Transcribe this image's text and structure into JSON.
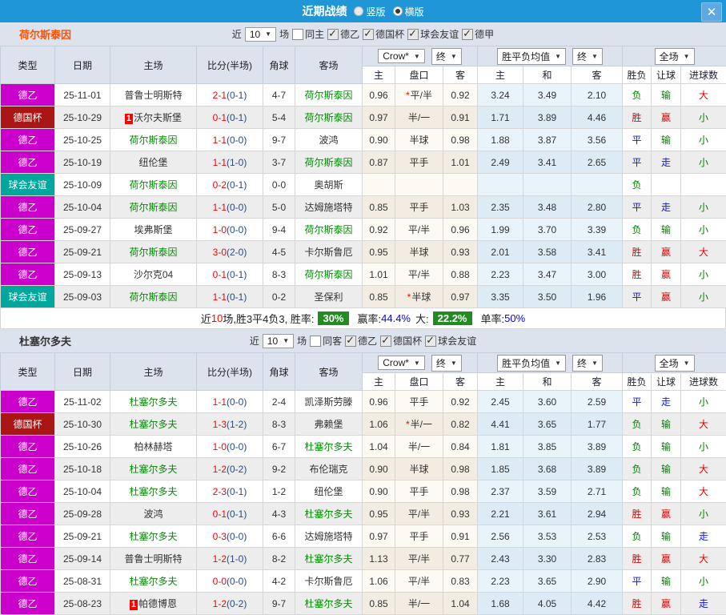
{
  "titlebar": {
    "title": "近期战绩",
    "radio_vertical": "竖版",
    "radio_horizontal": "横版",
    "close": "✕"
  },
  "labels": {
    "near": "近",
    "matches": "场"
  },
  "dd": {
    "crow": "Crow*",
    "final": "终",
    "avg": "胜平负均值",
    "full": "全场"
  },
  "table_header": {
    "league": "类型",
    "date": "日期",
    "home": "主场",
    "score": "比分(半场)",
    "corner": "角球",
    "away": "客场",
    "sub": [
      "主",
      "盘口",
      "客",
      "主",
      "和",
      "客",
      "胜负",
      "让球",
      "进球数"
    ]
  },
  "colors": {
    "topbar": "#1f96d5",
    "band": "#dde3ed",
    "score_red": "#ff0000",
    "halftime_navy": "#2b4b7c",
    "green_team": "#009000",
    "badge_green": "#228b22",
    "pct_blue": "#0000ff"
  },
  "league_colors": {
    "德乙": "#cc00cc",
    "德国杯": "#aa1616",
    "球会友谊": "#00a79d"
  },
  "result_colors": {
    "胜": "#e00000",
    "平": "#1414cc",
    "负": "#008000",
    "赢": "#e00000",
    "走": "#1414cc",
    "输": "#008000",
    "大": "#e00000",
    "小": "#008000"
  },
  "teams": [
    {
      "name": "荷尔斯泰因",
      "name_color": "#ff5100",
      "filters": {
        "count": "10",
        "same_label": "同主",
        "leagues": [
          "德乙",
          "德国杯",
          "球会友谊",
          "德甲"
        ]
      },
      "rows": [
        {
          "league": "德乙",
          "date": "25-11-01",
          "home": {
            "name": "普鲁士明斯特",
            "green": false,
            "badge": ""
          },
          "score": "2-1",
          "half": "(0-1)",
          "corner": "4-7",
          "away": {
            "name": "荷尔斯泰因",
            "green": true,
            "badge": ""
          },
          "asian": [
            "0.96",
            "平/半",
            "0.92"
          ],
          "star": true,
          "euro": [
            "3.24",
            "3.49",
            "2.10"
          ],
          "results": [
            "负",
            "输",
            "大"
          ]
        },
        {
          "league": "德国杯",
          "date": "25-10-29",
          "home": {
            "name": "沃尔夫斯堡",
            "green": false,
            "badge": "1"
          },
          "score": "0-1",
          "half": "(0-1)",
          "corner": "5-4",
          "away": {
            "name": "荷尔斯泰因",
            "green": true,
            "badge": ""
          },
          "asian": [
            "0.97",
            "半/一",
            "0.91"
          ],
          "star": false,
          "euro": [
            "1.71",
            "3.89",
            "4.46"
          ],
          "results": [
            "胜",
            "赢",
            "小"
          ]
        },
        {
          "league": "德乙",
          "date": "25-10-25",
          "home": {
            "name": "荷尔斯泰因",
            "green": true,
            "badge": ""
          },
          "score": "1-1",
          "half": "(0-0)",
          "corner": "9-7",
          "away": {
            "name": "波鸿",
            "green": false,
            "badge": ""
          },
          "asian": [
            "0.90",
            "半球",
            "0.98"
          ],
          "star": false,
          "euro": [
            "1.88",
            "3.87",
            "3.56"
          ],
          "results": [
            "平",
            "输",
            "小"
          ]
        },
        {
          "league": "德乙",
          "date": "25-10-19",
          "home": {
            "name": "纽伦堡",
            "green": false,
            "badge": ""
          },
          "score": "1-1",
          "half": "(1-0)",
          "corner": "3-7",
          "away": {
            "name": "荷尔斯泰因",
            "green": true,
            "badge": ""
          },
          "asian": [
            "0.87",
            "平手",
            "1.01"
          ],
          "star": false,
          "euro": [
            "2.49",
            "3.41",
            "2.65"
          ],
          "results": [
            "平",
            "走",
            "小"
          ]
        },
        {
          "league": "球会友谊",
          "date": "25-10-09",
          "home": {
            "name": "荷尔斯泰因",
            "green": true,
            "badge": ""
          },
          "score": "0-2",
          "half": "(0-1)",
          "corner": "0-0",
          "away": {
            "name": "奥胡斯",
            "green": false,
            "badge": ""
          },
          "asian": [
            "",
            "",
            ""
          ],
          "star": false,
          "euro": [
            "",
            "",
            ""
          ],
          "results": [
            "负",
            "",
            ""
          ]
        },
        {
          "league": "德乙",
          "date": "25-10-04",
          "home": {
            "name": "荷尔斯泰因",
            "green": true,
            "badge": ""
          },
          "score": "1-1",
          "half": "(0-0)",
          "corner": "5-0",
          "away": {
            "name": "达姆施塔特",
            "green": false,
            "badge": ""
          },
          "asian": [
            "0.85",
            "平手",
            "1.03"
          ],
          "star": false,
          "euro": [
            "2.35",
            "3.48",
            "2.80"
          ],
          "results": [
            "平",
            "走",
            "小"
          ]
        },
        {
          "league": "德乙",
          "date": "25-09-27",
          "home": {
            "name": "埃弗斯堡",
            "green": false,
            "badge": ""
          },
          "score": "1-0",
          "half": "(0-0)",
          "corner": "9-4",
          "away": {
            "name": "荷尔斯泰因",
            "green": true,
            "badge": ""
          },
          "asian": [
            "0.92",
            "平/半",
            "0.96"
          ],
          "star": false,
          "euro": [
            "1.99",
            "3.70",
            "3.39"
          ],
          "results": [
            "负",
            "输",
            "小"
          ]
        },
        {
          "league": "德乙",
          "date": "25-09-21",
          "home": {
            "name": "荷尔斯泰因",
            "green": true,
            "badge": ""
          },
          "score": "3-0",
          "half": "(2-0)",
          "corner": "4-5",
          "away": {
            "name": "卡尔斯鲁厄",
            "green": false,
            "badge": ""
          },
          "asian": [
            "0.95",
            "半球",
            "0.93"
          ],
          "star": false,
          "euro": [
            "2.01",
            "3.58",
            "3.41"
          ],
          "results": [
            "胜",
            "赢",
            "大"
          ]
        },
        {
          "league": "德乙",
          "date": "25-09-13",
          "home": {
            "name": "沙尔克04",
            "green": false,
            "badge": ""
          },
          "score": "0-1",
          "half": "(0-1)",
          "corner": "8-3",
          "away": {
            "name": "荷尔斯泰因",
            "green": true,
            "badge": ""
          },
          "asian": [
            "1.01",
            "平/半",
            "0.88"
          ],
          "star": false,
          "euro": [
            "2.23",
            "3.47",
            "3.00"
          ],
          "results": [
            "胜",
            "赢",
            "小"
          ]
        },
        {
          "league": "球会友谊",
          "date": "25-09-03",
          "home": {
            "name": "荷尔斯泰因",
            "green": true,
            "badge": ""
          },
          "score": "1-1",
          "half": "(0-1)",
          "corner": "0-2",
          "away": {
            "name": "圣保利",
            "green": false,
            "badge": ""
          },
          "asian": [
            "0.85",
            "半球",
            "0.97"
          ],
          "star": true,
          "euro": [
            "3.35",
            "3.50",
            "1.96"
          ],
          "results": [
            "平",
            "赢",
            "小"
          ]
        }
      ],
      "summary": {
        "seg_near": "近",
        "count": "10",
        "seg_record": "场,胜3平4负3, 胜率:",
        "win_rate": "30%",
        "lbl_win_odds": "赢率:",
        "win_odds_pct": "44.4%",
        "lbl_big": "大:",
        "big_pct": "22.2%",
        "lbl_single": "单率:",
        "single_pct": "50%"
      }
    },
    {
      "name": "杜塞尔多夫",
      "name_color": "#333333",
      "filters": {
        "count": "10",
        "same_label": "同客",
        "leagues": [
          "德乙",
          "德国杯",
          "球会友谊"
        ]
      },
      "rows": [
        {
          "league": "德乙",
          "date": "25-11-02",
          "home": {
            "name": "杜塞尔多夫",
            "green": true,
            "badge": ""
          },
          "score": "1-1",
          "half": "(0-0)",
          "corner": "2-4",
          "away": {
            "name": "凯泽斯劳滕",
            "green": false,
            "badge": ""
          },
          "asian": [
            "0.96",
            "平手",
            "0.92"
          ],
          "star": false,
          "euro": [
            "2.45",
            "3.60",
            "2.59"
          ],
          "results": [
            "平",
            "走",
            "小"
          ]
        },
        {
          "league": "德国杯",
          "date": "25-10-30",
          "home": {
            "name": "杜塞尔多夫",
            "green": true,
            "badge": ""
          },
          "score": "1-3",
          "half": "(1-2)",
          "corner": "8-3",
          "away": {
            "name": "弗赖堡",
            "green": false,
            "badge": ""
          },
          "asian": [
            "1.06",
            "半/一",
            "0.82"
          ],
          "star": true,
          "euro": [
            "4.41",
            "3.65",
            "1.77"
          ],
          "results": [
            "负",
            "输",
            "大"
          ]
        },
        {
          "league": "德乙",
          "date": "25-10-26",
          "home": {
            "name": "柏林赫塔",
            "green": false,
            "badge": ""
          },
          "score": "1-0",
          "half": "(0-0)",
          "corner": "6-7",
          "away": {
            "name": "杜塞尔多夫",
            "green": true,
            "badge": ""
          },
          "asian": [
            "1.04",
            "半/一",
            "0.84"
          ],
          "star": false,
          "euro": [
            "1.81",
            "3.85",
            "3.89"
          ],
          "results": [
            "负",
            "输",
            "小"
          ]
        },
        {
          "league": "德乙",
          "date": "25-10-18",
          "home": {
            "name": "杜塞尔多夫",
            "green": true,
            "badge": ""
          },
          "score": "1-2",
          "half": "(0-2)",
          "corner": "9-2",
          "away": {
            "name": "布伦瑞克",
            "green": false,
            "badge": ""
          },
          "asian": [
            "0.90",
            "半球",
            "0.98"
          ],
          "star": false,
          "euro": [
            "1.85",
            "3.68",
            "3.89"
          ],
          "results": [
            "负",
            "输",
            "大"
          ]
        },
        {
          "league": "德乙",
          "date": "25-10-04",
          "home": {
            "name": "杜塞尔多夫",
            "green": true,
            "badge": ""
          },
          "score": "2-3",
          "half": "(0-1)",
          "corner": "1-2",
          "away": {
            "name": "纽伦堡",
            "green": false,
            "badge": ""
          },
          "asian": [
            "0.90",
            "平手",
            "0.98"
          ],
          "star": false,
          "euro": [
            "2.37",
            "3.59",
            "2.71"
          ],
          "results": [
            "负",
            "输",
            "大"
          ]
        },
        {
          "league": "德乙",
          "date": "25-09-28",
          "home": {
            "name": "波鸿",
            "green": false,
            "badge": ""
          },
          "score": "0-1",
          "half": "(0-1)",
          "corner": "4-3",
          "away": {
            "name": "杜塞尔多夫",
            "green": true,
            "badge": ""
          },
          "asian": [
            "0.95",
            "平/半",
            "0.93"
          ],
          "star": false,
          "euro": [
            "2.21",
            "3.61",
            "2.94"
          ],
          "results": [
            "胜",
            "赢",
            "小"
          ]
        },
        {
          "league": "德乙",
          "date": "25-09-21",
          "home": {
            "name": "杜塞尔多夫",
            "green": true,
            "badge": ""
          },
          "score": "0-3",
          "half": "(0-0)",
          "corner": "6-6",
          "away": {
            "name": "达姆施塔特",
            "green": false,
            "badge": ""
          },
          "asian": [
            "0.97",
            "平手",
            "0.91"
          ],
          "star": false,
          "euro": [
            "2.56",
            "3.53",
            "2.53"
          ],
          "results": [
            "负",
            "输",
            "走"
          ]
        },
        {
          "league": "德乙",
          "date": "25-09-14",
          "home": {
            "name": "普鲁士明斯特",
            "green": false,
            "badge": ""
          },
          "score": "1-2",
          "half": "(1-0)",
          "corner": "8-2",
          "away": {
            "name": "杜塞尔多夫",
            "green": true,
            "badge": ""
          },
          "asian": [
            "1.13",
            "平/半",
            "0.77"
          ],
          "star": false,
          "euro": [
            "2.43",
            "3.30",
            "2.83"
          ],
          "results": [
            "胜",
            "赢",
            "大"
          ]
        },
        {
          "league": "德乙",
          "date": "25-08-31",
          "home": {
            "name": "杜塞尔多夫",
            "green": true,
            "badge": ""
          },
          "score": "0-0",
          "half": "(0-0)",
          "corner": "4-2",
          "away": {
            "name": "卡尔斯鲁厄",
            "green": false,
            "badge": ""
          },
          "asian": [
            "1.06",
            "平/半",
            "0.83"
          ],
          "star": false,
          "euro": [
            "2.23",
            "3.65",
            "2.90"
          ],
          "results": [
            "平",
            "输",
            "小"
          ]
        },
        {
          "league": "德乙",
          "date": "25-08-23",
          "home": {
            "name": "帕德博恩",
            "green": false,
            "badge": "1"
          },
          "score": "1-2",
          "half": "(0-2)",
          "corner": "9-7",
          "away": {
            "name": "杜塞尔多夫",
            "green": true,
            "badge": ""
          },
          "asian": [
            "0.85",
            "半/一",
            "1.04"
          ],
          "star": false,
          "euro": [
            "1.68",
            "4.05",
            "4.42"
          ],
          "results": [
            "胜",
            "赢",
            "走"
          ]
        }
      ]
    }
  ]
}
